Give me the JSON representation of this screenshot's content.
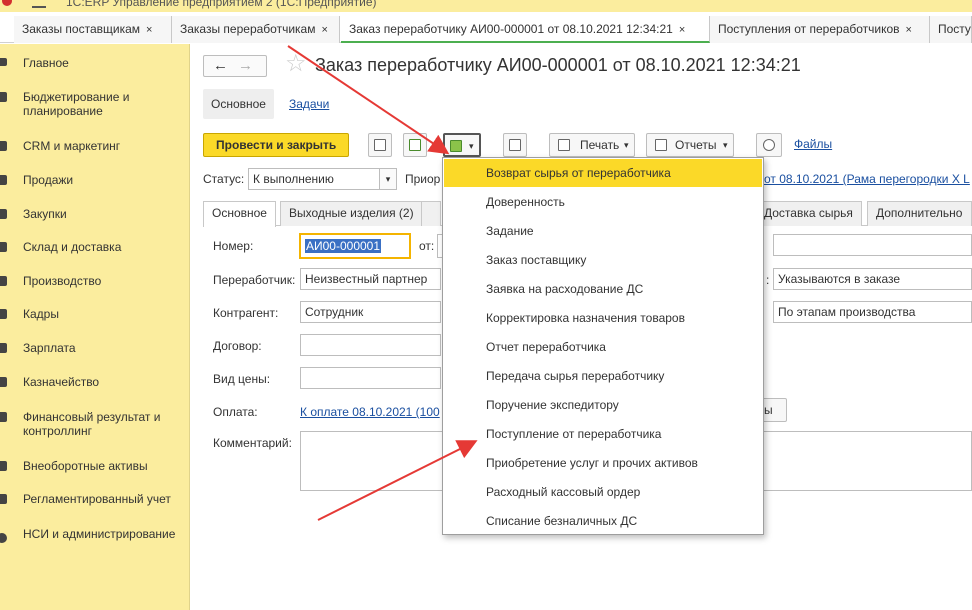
{
  "window": {
    "title": "1С:ERP Управление предприятием 2  (1С:Предприятие)"
  },
  "tabs": [
    {
      "label": "Заказы поставщикам",
      "close": "×"
    },
    {
      "label": "Заказы переработчикам",
      "close": "×"
    },
    {
      "label": "Заказ переработчику АИ00-000001 от 08.10.2021 12:34:21",
      "close": "×"
    },
    {
      "label": "Поступления от переработчиков",
      "close": "×"
    },
    {
      "label": "Посту"
    }
  ],
  "sidebar": {
    "items": [
      {
        "label": "Главное",
        "icon": "menu-icon"
      },
      {
        "label": "Бюджетирование и планирование",
        "icon": "budget-icon"
      },
      {
        "label": "CRM и маркетинг",
        "icon": "crm-icon"
      },
      {
        "label": "Продажи",
        "icon": "sales-icon"
      },
      {
        "label": "Закупки",
        "icon": "purchases-icon"
      },
      {
        "label": "Склад и доставка",
        "icon": "warehouse-icon"
      },
      {
        "label": "Производство",
        "icon": "production-icon"
      },
      {
        "label": "Кадры",
        "icon": "personnel-icon"
      },
      {
        "label": "Зарплата",
        "icon": "salary-icon"
      },
      {
        "label": "Казначейство",
        "icon": "treasury-icon"
      },
      {
        "label": "Финансовый результат и контроллинг",
        "icon": "finance-icon"
      },
      {
        "label": "Внеоборотные активы",
        "icon": "assets-icon"
      },
      {
        "label": "Регламентированный учет",
        "icon": "accounting-icon"
      },
      {
        "label": "НСИ и администрирование",
        "icon": "gear-icon"
      }
    ]
  },
  "document": {
    "title": "Заказ переработчику АИ00-000001 от 08.10.2021 12:34:21",
    "nav_back": "←",
    "nav_forward": "→",
    "star": "☆"
  },
  "subtabs": {
    "main": "Основное",
    "tasks": "Задачи"
  },
  "toolbar": {
    "post_close": "Провести и закрыть",
    "print": "Печать",
    "reports": "Отчеты",
    "files": "Файлы",
    "dropdown_arrow": "▾"
  },
  "status": {
    "label": "Статус:",
    "value": "К выполнению",
    "priority_label": "Приор",
    "right_link": "от 08.10.2021 (Рама перегородки Х L"
  },
  "formtabs": {
    "main": "Основное",
    "outputs": "Выходные изделия (2)",
    "delivery": "Доставка сырья",
    "extra": "Дополнительно"
  },
  "form": {
    "number_label": "Номер:",
    "number_value": "АИ00-000001",
    "from_label": "от:",
    "processor_label": "Переработчик:",
    "processor_value": "Неизвестный партнер",
    "contractor_label": "Контрагент:",
    "contractor_value": "Сотрудник",
    "contract_label": "Договор:",
    "price_label": "Вид цены:",
    "payment_label": "Оплата:",
    "payment_link": "К оплате 08.10.2021 (100",
    "payment_btn_tail": "ы",
    "comment_label": "Комментарий:",
    "right_field1": "Указываются в заказе",
    "right_label_tail": ":",
    "right_field2": "По этапам производства"
  },
  "dropdown": {
    "items": [
      "Возврат сырья от переработчика",
      "Доверенность",
      "Задание",
      "Заказ поставщику",
      "Заявка на расходование ДС",
      "Корректировка назначения товаров",
      "Отчет переработчика",
      "Передача сырья переработчику",
      "Поручение экспедитору",
      "Поступление от переработчика",
      "Приобретение услуг и прочих активов",
      "Расходный кассовый ордер",
      "Списание безналичных ДС"
    ],
    "highlighted_index": 0
  },
  "colors": {
    "accent": "#fbd928",
    "sidebar": "#fbed9e",
    "link": "#1a4fa0",
    "arrow": "#e53935"
  }
}
